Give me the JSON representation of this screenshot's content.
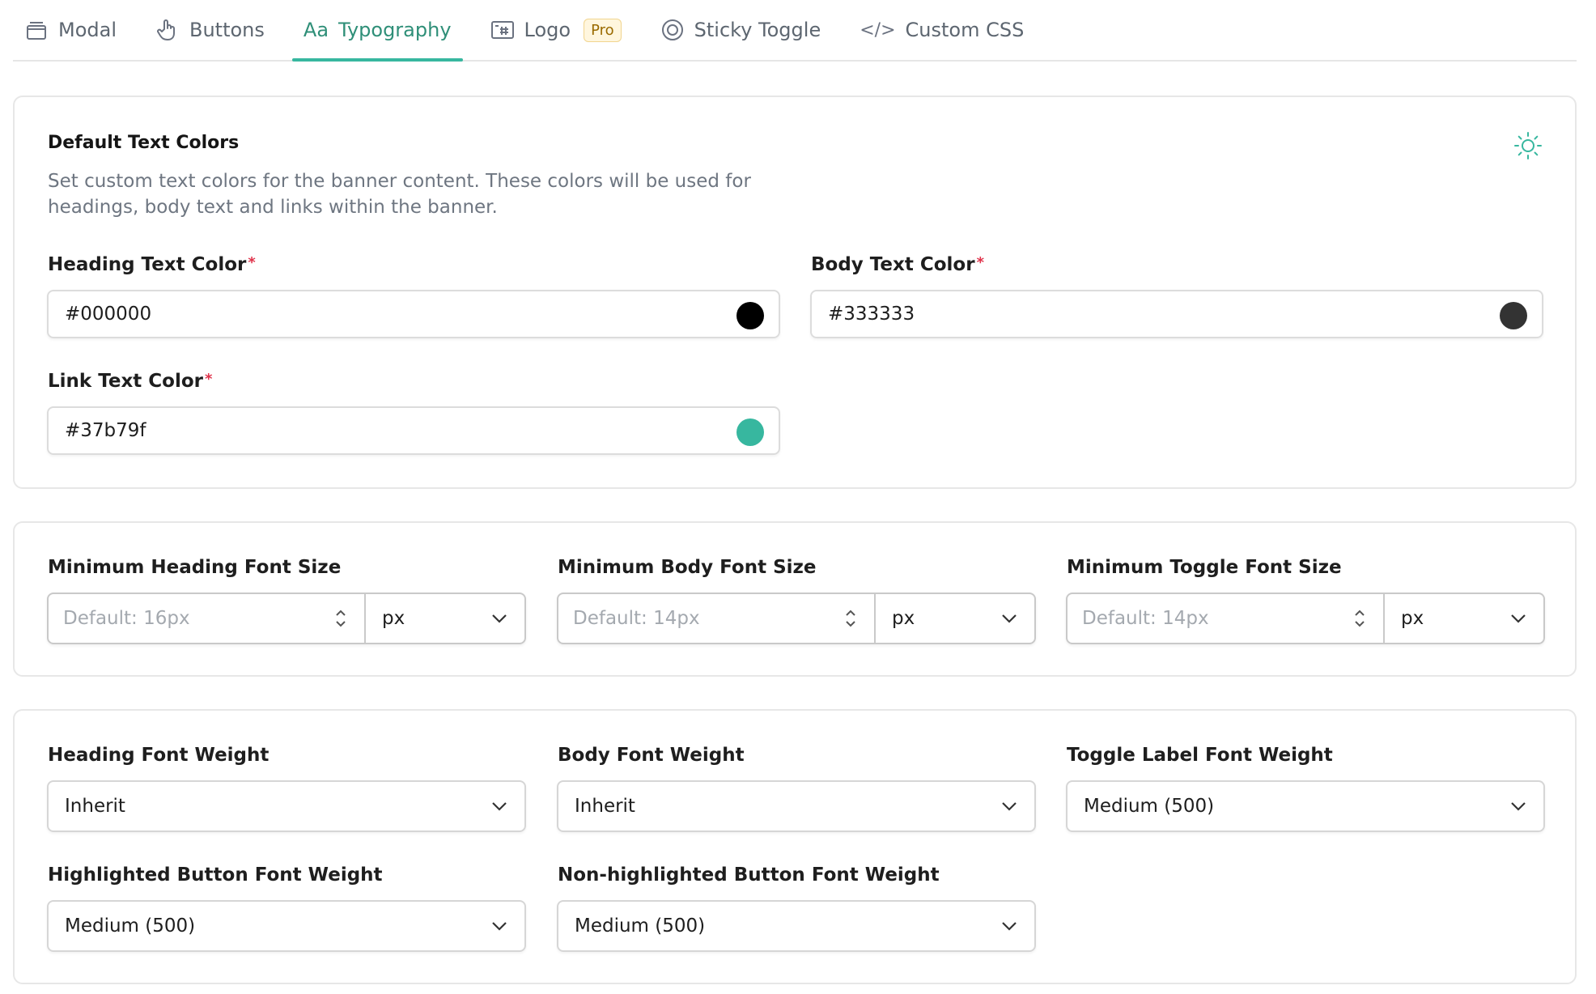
{
  "tabs": [
    {
      "label": "Modal",
      "icon": "window-stack-icon",
      "active": false
    },
    {
      "label": "Buttons",
      "icon": "pointer-hand-icon",
      "active": false
    },
    {
      "label": "Typography",
      "icon": "typography-icon",
      "active": true,
      "icon_text": "Aa"
    },
    {
      "label": "Logo",
      "icon": "image-grid-icon",
      "active": false,
      "badge": "Pro"
    },
    {
      "label": "Sticky Toggle",
      "icon": "target-icon",
      "active": false
    },
    {
      "label": "Custom CSS",
      "icon": "code-icon",
      "active": false,
      "icon_text": "</>"
    }
  ],
  "colors_card": {
    "title": "Default Text Colors",
    "description": "Set custom text colors for the banner content. These colors will be used for headings, body text and links within the banner.",
    "heading": {
      "label": "Heading Text Color",
      "required": "*",
      "value": "#000000",
      "swatch": "#000000"
    },
    "body": {
      "label": "Body Text Color",
      "required": "*",
      "value": "#333333",
      "swatch": "#333333"
    },
    "link": {
      "label": "Link Text Color",
      "required": "*",
      "value": "#37b79f",
      "swatch": "#37b79f"
    }
  },
  "sizes_card": {
    "heading": {
      "label": "Minimum Heading Font Size",
      "placeholder": "Default: 16px",
      "unit": "px"
    },
    "body": {
      "label": "Minimum Body Font Size",
      "placeholder": "Default: 14px",
      "unit": "px"
    },
    "toggle": {
      "label": "Minimum Toggle Font Size",
      "placeholder": "Default: 14px",
      "unit": "px"
    }
  },
  "weights_card": {
    "heading": {
      "label": "Heading Font Weight",
      "value": "Inherit"
    },
    "body": {
      "label": "Body Font Weight",
      "value": "Inherit"
    },
    "toggle": {
      "label": "Toggle Label Font Weight",
      "value": "Medium (500)"
    },
    "highlighted": {
      "label": "Highlighted Button Font Weight",
      "value": "Medium (500)"
    },
    "nonhighlighted": {
      "label": "Non-highlighted Button Font Weight",
      "value": "Medium (500)"
    }
  },
  "colors": {
    "accent": "#37b79f",
    "accent_text": "#2f8f78",
    "required": "#e0334b"
  }
}
